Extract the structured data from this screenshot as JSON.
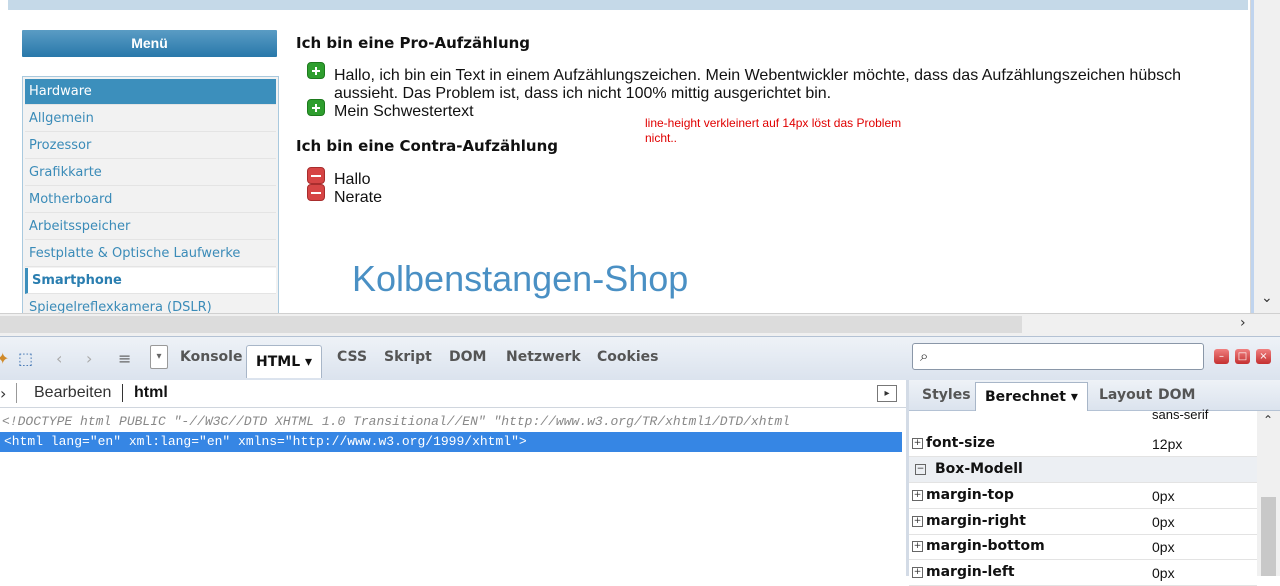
{
  "page": {
    "menu_title": "Menü",
    "menu_items": [
      {
        "label": "Hardware",
        "state": "active"
      },
      {
        "label": "Allgemein",
        "state": "normal"
      },
      {
        "label": "Prozessor",
        "state": "normal"
      },
      {
        "label": "Grafikkarte",
        "state": "normal"
      },
      {
        "label": "Motherboard",
        "state": "normal"
      },
      {
        "label": "Arbeitsspeicher",
        "state": "normal"
      },
      {
        "label": "Festplatte & Optische Laufwerke",
        "state": "normal"
      },
      {
        "label": "Smartphone",
        "state": "current"
      },
      {
        "label": "Spiegelreflexkamera (DSLR)",
        "state": "normal"
      }
    ],
    "pro_heading": "Ich bin eine Pro-Aufzählung",
    "pro_items": [
      "Hallo, ich bin ein Text in einem Aufzählungszeichen. Mein Webentwickler möchte, dass das Aufzählungszeichen hübsch aussieht. Das Problem ist, dass ich nicht 100% mittig ausgerichtet bin.",
      "Mein Schwestertext"
    ],
    "contra_heading": "Ich bin eine Contra-Aufzählung",
    "contra_items": [
      "Hallo",
      "Nerate"
    ],
    "note": "line-height verkleinert auf 14px löst das Problem nicht..",
    "shop_title": "Kolbenstangen-Shop"
  },
  "firebug": {
    "tabs": [
      "Konsole",
      "HTML ▾",
      "CSS",
      "Skript",
      "DOM",
      "Netzwerk",
      "Cookies"
    ],
    "selected_tab": "HTML ▾",
    "breadcrumb_edit": "Bearbeiten",
    "breadcrumb_node": "html",
    "doctype_line": "<!DOCTYPE html PUBLIC \"-//W3C//DTD XHTML 1.0 Transitional//EN\" \"http://www.w3.org/TR/xhtml1/DTD/xhtml",
    "html_line": "<html lang=\"en\" xml:lang=\"en\" xmlns=\"http://www.w3.org/1999/xhtml\">",
    "side_tabs": [
      "Styles",
      "Berechnet ▾",
      "Layout",
      "DOM"
    ],
    "side_selected": "Berechnet ▾",
    "computed": [
      {
        "name": "",
        "value": "sans-serif",
        "kind": "value-only"
      },
      {
        "name": "font-size",
        "value": "12px",
        "kind": "prop"
      },
      {
        "name": "Box-Modell",
        "value": "",
        "kind": "section"
      },
      {
        "name": "margin-top",
        "value": "0px",
        "kind": "prop"
      },
      {
        "name": "margin-right",
        "value": "0px",
        "kind": "prop"
      },
      {
        "name": "margin-bottom",
        "value": "0px",
        "kind": "prop"
      },
      {
        "name": "margin-left",
        "value": "0px",
        "kind": "prop"
      }
    ]
  },
  "colors": {
    "accent": "#3c8fbc",
    "selection": "#3686e4",
    "note_red": "#e00000"
  }
}
